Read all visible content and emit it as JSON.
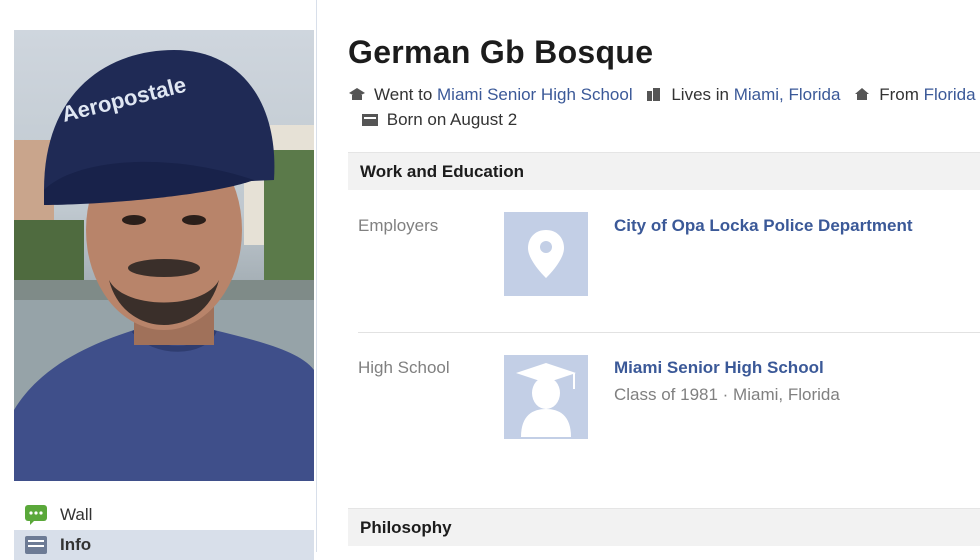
{
  "profile": {
    "name": "German Gb Bosque",
    "cap_text": "Aeropostale"
  },
  "meta": {
    "went_to_prefix": "Went to",
    "school_link": "Miami Senior High School",
    "lives_prefix": "Lives in",
    "lives_link": "Miami, Florida",
    "from_prefix": "From",
    "from_link": "Florida",
    "born": "Born on August 2"
  },
  "sections": {
    "work_education_title": "Work and Education",
    "philosophy_title": "Philosophy"
  },
  "employers": {
    "label": "Employers",
    "name": "City of Opa Locka Police Department"
  },
  "high_school": {
    "label": "High School",
    "name": "Miami Senior High School",
    "detail": "Class of 1981 · Miami, Florida"
  },
  "side_nav": {
    "items": [
      {
        "label": "Wall",
        "icon": "wall-icon"
      },
      {
        "label": "Info",
        "icon": "info-icon"
      }
    ]
  },
  "colors": {
    "link": "#3b5998",
    "placeholder": "#c3cfe6",
    "nav_active": "#d8dfea"
  }
}
